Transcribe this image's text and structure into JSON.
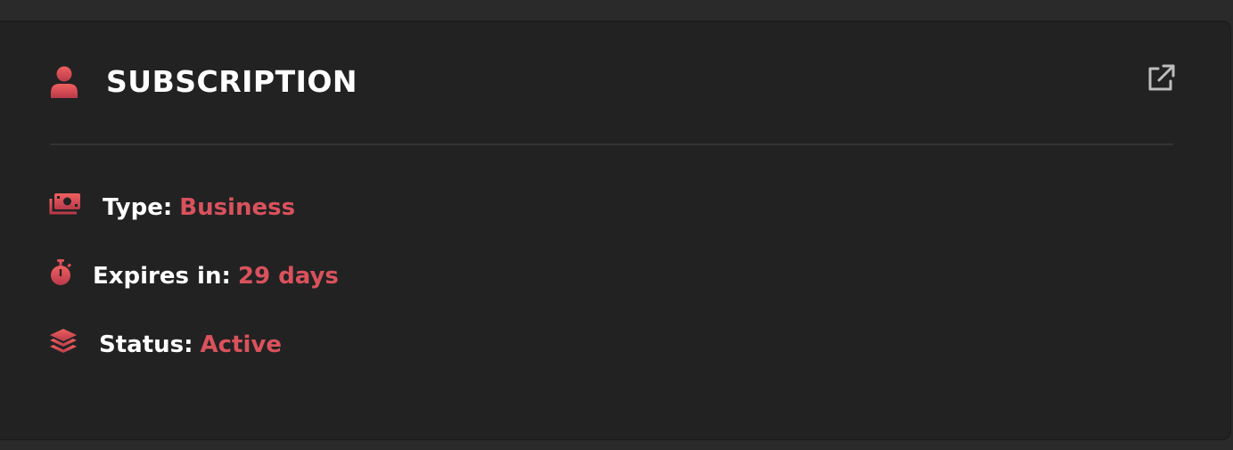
{
  "card": {
    "title": "SUBSCRIPTION",
    "header_icon": "user-icon",
    "action_icon": "external-link-icon"
  },
  "details": {
    "type": {
      "label": "Type:",
      "value": "Business",
      "icon": "money-icon"
    },
    "expires": {
      "label": "Expires in:",
      "value": "29 days",
      "icon": "stopwatch-icon"
    },
    "status": {
      "label": "Status:",
      "value": "Active",
      "icon": "layers-icon"
    }
  },
  "colors": {
    "accent": "#d9525c",
    "background": "#222223",
    "text": "#ffffff"
  }
}
